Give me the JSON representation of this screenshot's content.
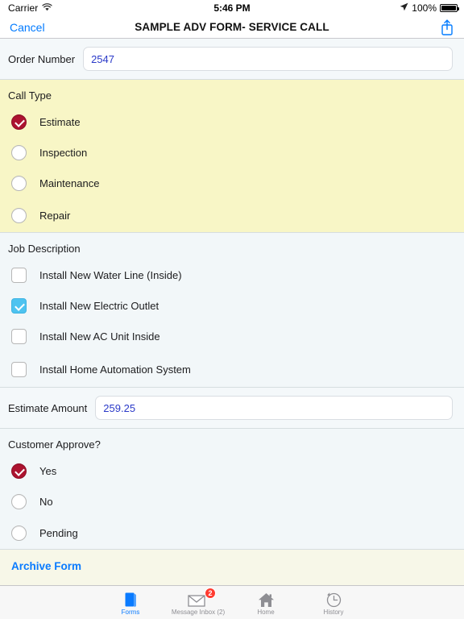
{
  "status_bar": {
    "carrier": "Carrier",
    "wifi_icon": "wifi-icon",
    "time": "5:46 PM",
    "location_icon": "location-arrow-icon",
    "battery_percent": "100%",
    "battery_icon": "battery-full-icon"
  },
  "nav_bar": {
    "cancel_label": "Cancel",
    "title": "SAMPLE ADV FORM- SERVICE CALL",
    "share_icon": "share-icon",
    "accent_color": "#007aff"
  },
  "form": {
    "order_number": {
      "label": "Order Number",
      "value": "2547",
      "placeholder": ""
    },
    "call_type": {
      "title": "Call Type",
      "background_color": "#f8f6c6",
      "selected": "Estimate",
      "options": [
        {
          "label": "Estimate",
          "selected": true
        },
        {
          "label": "Inspection",
          "selected": false
        },
        {
          "label": "Maintenance",
          "selected": false
        },
        {
          "label": "Repair",
          "selected": false
        }
      ]
    },
    "job_description": {
      "title": "Job Description",
      "options": [
        {
          "label": "Install New Water Line (Inside)",
          "checked": false
        },
        {
          "label": "Install New Electric Outlet",
          "checked": true
        },
        {
          "label": "Install New AC Unit Inside",
          "checked": false
        },
        {
          "label": "Install Home Automation System",
          "checked": false
        }
      ]
    },
    "estimate_amount": {
      "label": "Estimate Amount",
      "value": "259.25",
      "placeholder": ""
    },
    "customer_approve": {
      "title": "Customer Approve?",
      "selected": "Yes",
      "options": [
        {
          "label": "Yes",
          "selected": true
        },
        {
          "label": "No",
          "selected": false
        },
        {
          "label": "Pending",
          "selected": false
        }
      ]
    },
    "archive_link": {
      "label": "Archive Form",
      "background_color": "#f7f7e8",
      "color": "#0a7bff"
    },
    "selected_radio_color": "#ad1330",
    "checked_box_color": "#4ec3f0",
    "value_text_color": "#2a39c8"
  },
  "tab_bar": [
    {
      "label": "Forms",
      "icon": "forms-icon",
      "active": true,
      "badge": ""
    },
    {
      "label": "Message Inbox (2)",
      "icon": "envelope-icon",
      "active": false,
      "badge": "2"
    },
    {
      "label": "Home",
      "icon": "home-icon",
      "active": false,
      "badge": ""
    },
    {
      "label": "History",
      "icon": "clock-history-icon",
      "active": false,
      "badge": ""
    }
  ]
}
